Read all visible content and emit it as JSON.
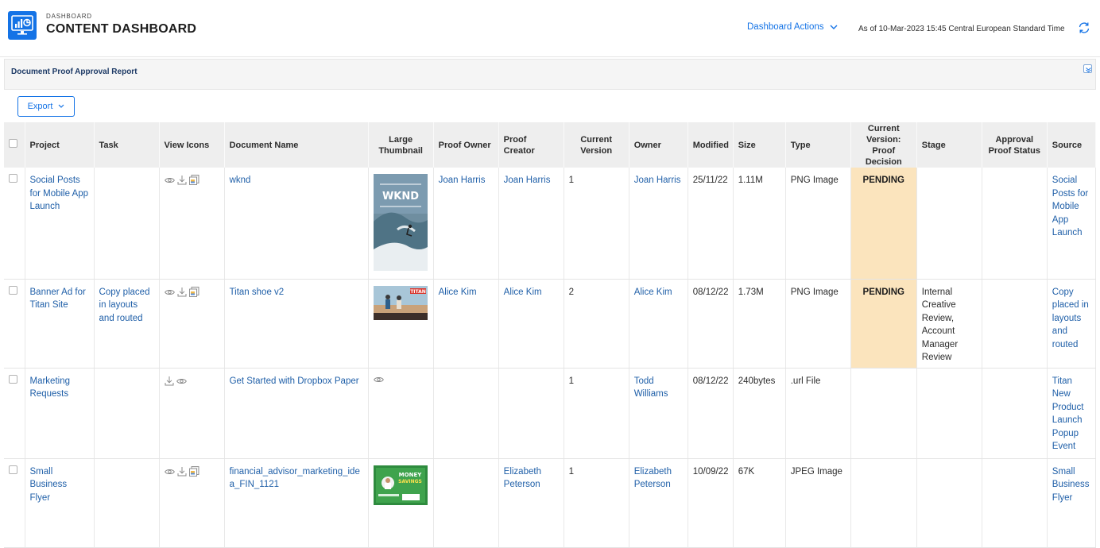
{
  "header": {
    "eyebrow": "DASHBOARD",
    "title": "CONTENT DASHBOARD",
    "actions_label": "Dashboard Actions",
    "as_of": "As of  10-Mar-2023 15:45 Central European Standard Time"
  },
  "report": {
    "title": "Document Proof Approval Report",
    "export_label": "Export"
  },
  "columns": {
    "project": "Project",
    "task": "Task",
    "view_icons": "View Icons",
    "document_name": "Document Name",
    "thumb_l1": "Large",
    "thumb_l2": "Thumbnail",
    "proof_owner": "Proof Owner",
    "proof_creator": "Proof Creator",
    "cur_l1": "Current",
    "cur_l2": "Version",
    "owner": "Owner",
    "modified": "Modified",
    "size": "Size",
    "type": "Type",
    "dec_l1": "Current",
    "dec_l2": "Version: Proof",
    "dec_l3": "Decision",
    "stage": "Stage",
    "aps_l1": "Approval",
    "aps_l2": "Proof Status",
    "source": "Source"
  },
  "thumb_text": {
    "wknd": "WKND",
    "titan": "TITAN",
    "money_l1": "MONEY",
    "money_l2": "SAVINGS"
  },
  "rows": [
    {
      "project": "Social Posts for Mobile App Launch",
      "task": "",
      "document_name": "wknd",
      "proof_owner": "Joan Harris",
      "proof_creator": "Joan Harris",
      "current_version": "1",
      "owner": "Joan Harris",
      "modified": "25/11/22",
      "size": "1.11M",
      "type": "PNG Image",
      "decision": "PENDING",
      "stage": "",
      "approval_status": "",
      "source": "Social Posts for Mobile App Launch"
    },
    {
      "project": "Banner Ad for Titan Site",
      "task": "Copy placed in layouts and routed",
      "document_name": "Titan shoe v2",
      "proof_owner": "Alice Kim",
      "proof_creator": "Alice Kim",
      "current_version": "2",
      "owner": "Alice Kim",
      "modified": "08/12/22",
      "size": "1.73M",
      "type": "PNG Image",
      "decision": "PENDING",
      "stage": "Internal Creative Review, Account Manager Review",
      "approval_status": "",
      "source": "Copy placed in layouts and routed"
    },
    {
      "project": "Marketing Requests",
      "task": "",
      "document_name": "Get Started with Dropbox Paper",
      "proof_owner": "",
      "proof_creator": "",
      "current_version": "1",
      "owner": "Todd Williams",
      "modified": "08/12/22",
      "size": "240bytes",
      "type": ".url File",
      "decision": "",
      "stage": "",
      "approval_status": "",
      "source": "Titan New Product Launch Popup Event"
    },
    {
      "project": "Small Business Flyer",
      "task": "",
      "document_name": "financial_advisor_marketing_idea_FIN_1121",
      "proof_owner": "",
      "proof_creator": "Elizabeth Peterson",
      "current_version": "1",
      "owner": "Elizabeth Peterson",
      "modified": "10/09/22",
      "size": "67K",
      "type": "JPEG Image",
      "decision": "",
      "stage": "",
      "approval_status": "",
      "source": "Small Business Flyer"
    }
  ],
  "icons": {
    "app": "dashboard-chart-icon",
    "dropdown": "chevron-down-icon",
    "refresh": "refresh-icon",
    "collapse": "collapse-icon",
    "view": "eye-icon",
    "download": "download-icon",
    "proof": "proof-image-icon"
  },
  "colors": {
    "accent": "#1473e6",
    "link": "#1f5fa8",
    "pending_bg": "#fbe4bd",
    "header_bg": "#eeeeee"
  }
}
